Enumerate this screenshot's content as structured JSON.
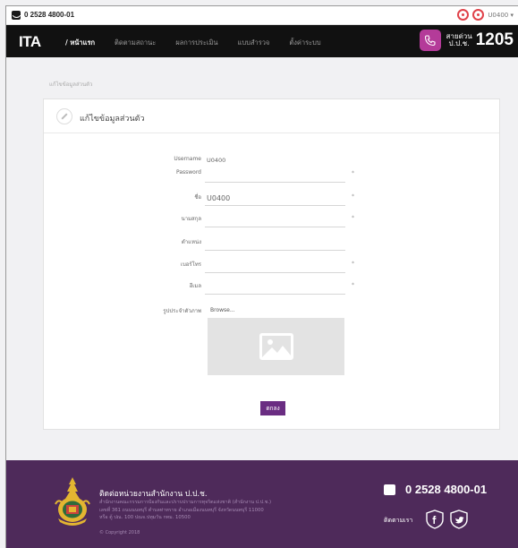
{
  "topbar": {
    "phone": "0 2528 4800-01",
    "user": "U0400 ▾"
  },
  "navbar": {
    "logo": "ITA",
    "items": [
      {
        "label": "/ หน้าแรก",
        "active": true
      },
      {
        "label": "ติดตามสถานะ",
        "active": false
      },
      {
        "label": "ผลการประเมิน",
        "active": false
      },
      {
        "label": "แบบสำรวจ",
        "active": false
      },
      {
        "label": "ตั้งค่าระบบ",
        "active": false
      }
    ],
    "hotline_label_1": "สายด่วน",
    "hotline_label_2": "ป.ป.ช.",
    "hotline_number": "1205"
  },
  "breadcrumb": "แก้ไขข้อมูลส่วนตัว",
  "card": {
    "title": "แก้ไขข้อมูลส่วนตัว"
  },
  "form": {
    "fields": [
      {
        "label": "Username",
        "value": "U0400",
        "required": false
      },
      {
        "label": "Password",
        "value": "",
        "required": true
      },
      {
        "label": "ชื่อ",
        "value": "U0400",
        "required": true
      },
      {
        "label": "นามสกุล",
        "value": "",
        "required": true
      },
      {
        "label": "ตำแหน่ง",
        "value": "",
        "required": false
      },
      {
        "label": "เบอร์โทร",
        "value": "",
        "required": true
      },
      {
        "label": "อีเมล",
        "value": "",
        "required": true
      },
      {
        "label": "รูปประจำตัวภาพ",
        "value": "Browse...",
        "required": false
      }
    ],
    "submit_label": "ตกลง"
  },
  "footer": {
    "org_name": "ติดต่อหน่วยงานสำนักงาน ป.ป.ช.",
    "address_lines": [
      "สำนักงานคณะกรรมการป้องกันและปราบปรามการทุจริตแห่งชาติ (สำนักงาน ป.ป.ช.)",
      "เลขที่ 361 ถนนนนทบุรี ตำบลท่าทราย อำเภอเมืองนนทบุรี จังหวัดนนทบุรี 11000",
      "หรือ ตู้ ปณ. 100 ปณจ.ปทุมวัน กทม. 10500"
    ],
    "copyright": "© Copyright 2018",
    "phone": "0 2528 4800-01",
    "follow_label": "ติดตามเรา"
  },
  "colors": {
    "brand_purple": "#4e2a5a",
    "button_purple": "#6a2d82",
    "hotline_pink": "#b43b99",
    "alert_red": "#e0424a"
  }
}
